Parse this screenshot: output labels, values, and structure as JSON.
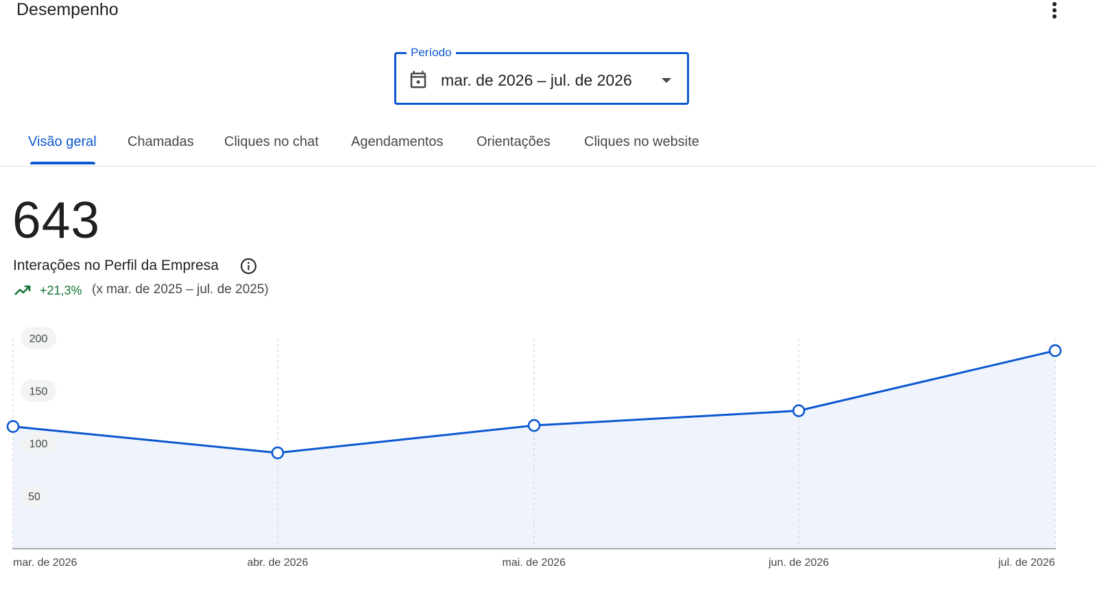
{
  "header": {
    "title": "Desempenho",
    "more_icon": "more-vert-icon"
  },
  "period": {
    "label": "Período",
    "value": "mar. de 2026 – jul. de 2026",
    "calendar_icon": "calendar-icon",
    "dropdown_icon": "arrow-drop-down-icon"
  },
  "tabs": [
    {
      "label": "Visão geral",
      "active": true
    },
    {
      "label": "Chamadas",
      "active": false
    },
    {
      "label": "Cliques no chat",
      "active": false
    },
    {
      "label": "Agendamentos",
      "active": false
    },
    {
      "label": "Orientações",
      "active": false
    },
    {
      "label": "Cliques no website",
      "active": false
    }
  ],
  "metric": {
    "value": "643",
    "label": "Interações no Perfil da Empresa",
    "info_icon": "info-icon",
    "trend_icon": "trending-up-icon",
    "change": "+21,3%",
    "comparison": "(x mar. de 2025 – jul. de 2025)"
  },
  "colors": {
    "accent": "#0b57d0",
    "positive": "#137333",
    "area_fill": "#eff4fc"
  },
  "chart_data": {
    "type": "area",
    "categories": [
      "mar. de 2026",
      "abr. de 2026",
      "mai. de 2026",
      "jun. de 2026",
      "jul. de 2026"
    ],
    "series": [
      {
        "values": [
          116,
          91,
          117,
          131,
          188
        ]
      }
    ],
    "yticks": [
      "50",
      "100",
      "150",
      "200"
    ],
    "ylim": [
      0,
      200
    ],
    "grid": "vertical-dashed",
    "legend": "none"
  }
}
